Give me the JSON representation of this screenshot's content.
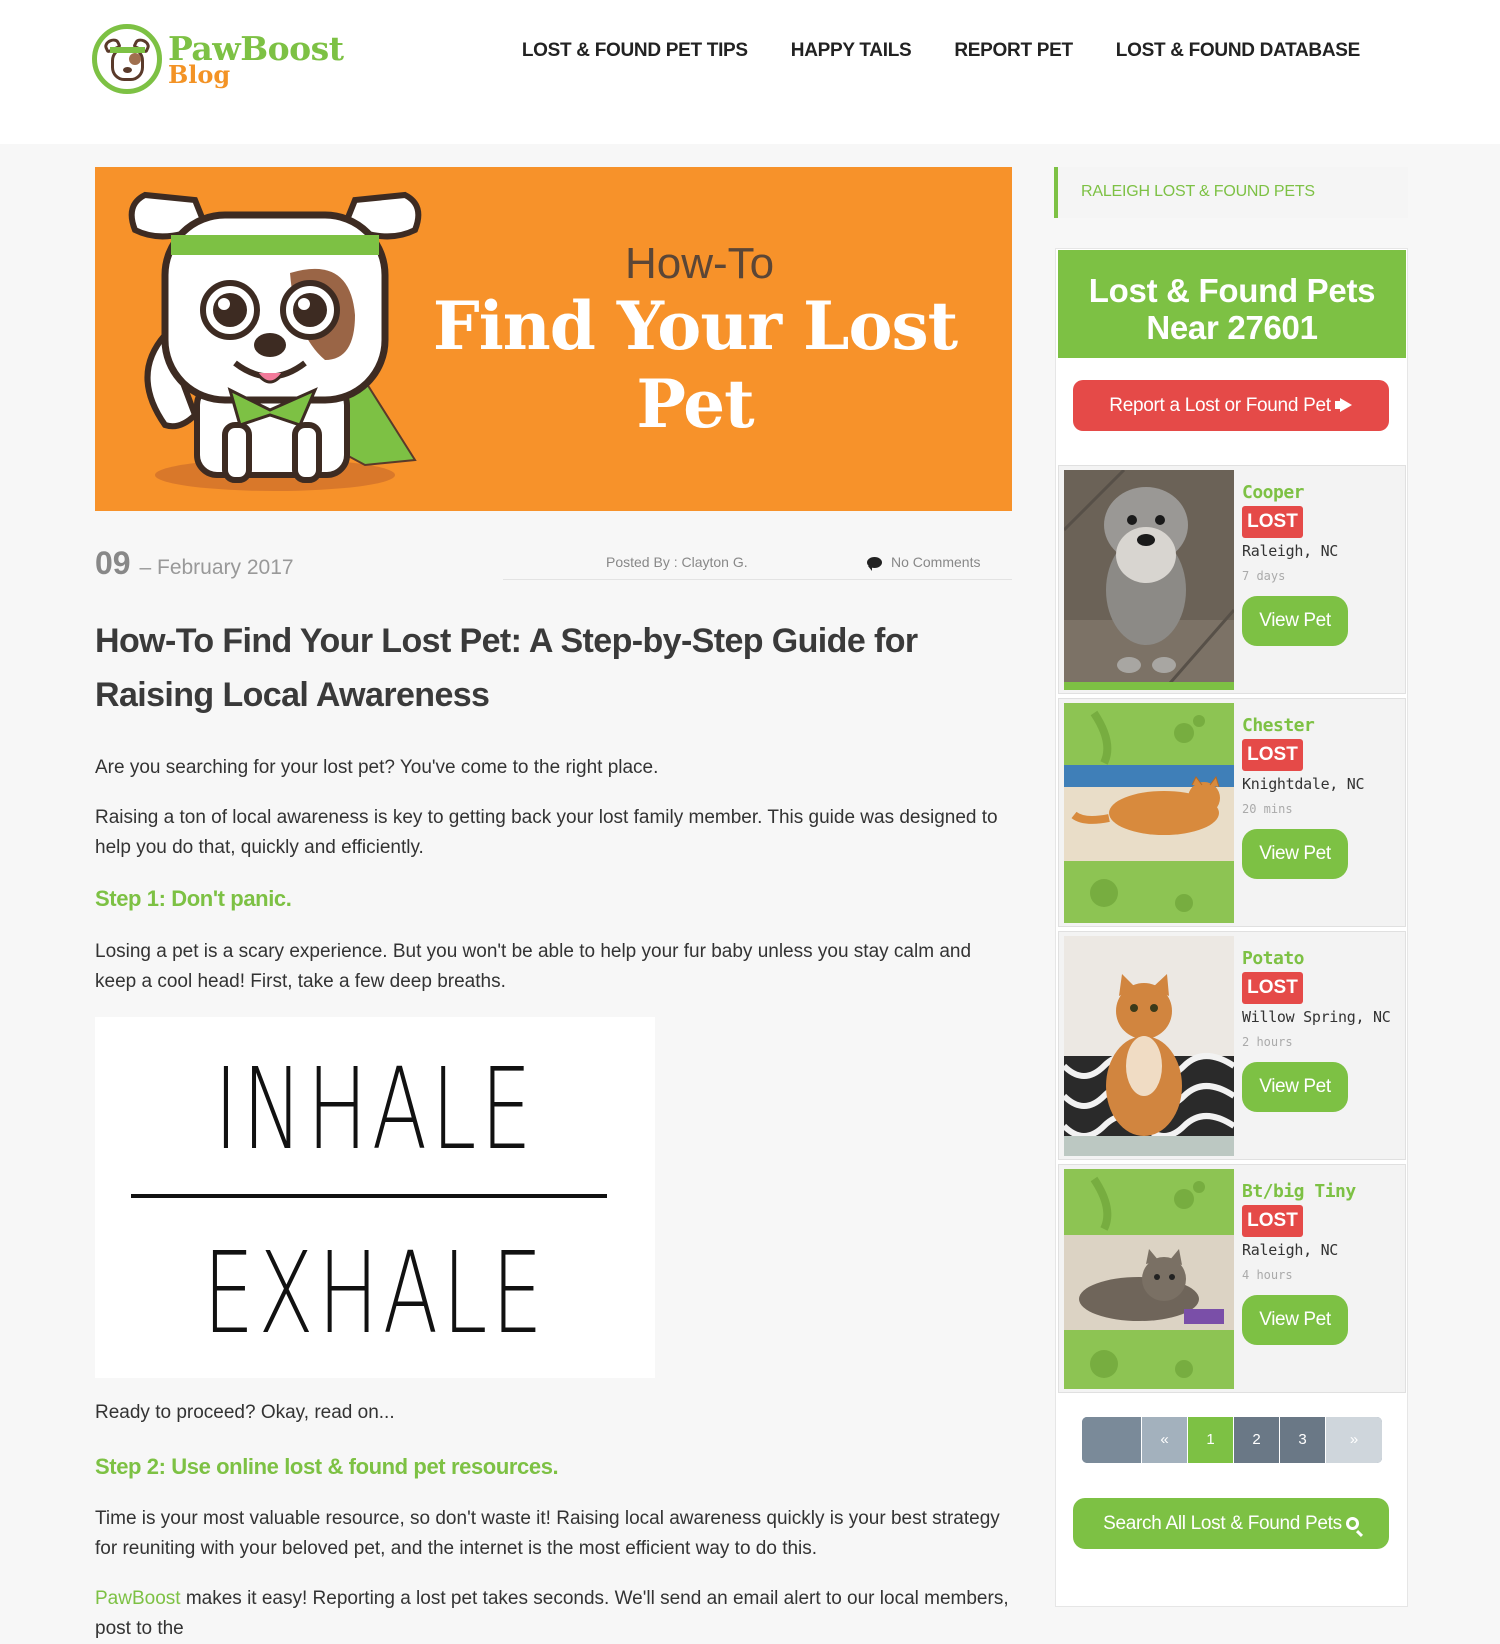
{
  "site": {
    "logo_line1": "PawBoost",
    "logo_line2": "Blog"
  },
  "nav": {
    "items": [
      "LOST & FOUND PET TIPS",
      "HAPPY TAILS",
      "REPORT PET",
      "LOST & FOUND DATABASE"
    ]
  },
  "hero": {
    "pre": "How-To",
    "title_line1": "Find Your Lost",
    "title_line2": "Pet",
    "bg_color": "#f7922a"
  },
  "meta": {
    "day": "09",
    "month_year": "– February 2017",
    "posted_by": "Posted By : Clayton G.",
    "comments": "No Comments"
  },
  "article": {
    "title": "How-To Find Your Lost Pet: A Step-by-Step Guide for Raising Local Awareness",
    "p1": "Are you searching for your lost pet? You've come to the right place.",
    "p2": "Raising a ton of local awareness is key to getting back your lost family member. This guide was designed to help you do that, quickly and efficiently.",
    "step1": "Step 1: Don't panic.",
    "p3": "Losing a pet is a scary experience. But you won't be able to help your fur baby unless you stay calm and keep a cool head! First, take a few deep breaths.",
    "image_word1": "INHALE",
    "image_word2": "EXHALE",
    "p4": "Ready to proceed? Okay, read on...",
    "step2": "Step 2: Use online lost & found pet resources.",
    "p5": "Time is your most valuable resource, so don't waste it! Raising local awareness quickly is your best strategy for reuniting with your beloved pet, and the internet is the most efficient way to do this.",
    "p6_link": "PawBoost",
    "p6_rest": " makes it easy! Reporting a lost pet takes seconds. We'll send an email alert to our local members, post to the"
  },
  "sidebar": {
    "heading": "RALEIGH LOST & FOUND PETS",
    "box_title_line1": "Lost & Found Pets",
    "box_title_line2": "Near 27601",
    "report_button": "Report a Lost or Found Pet",
    "pets": [
      {
        "name": "Cooper",
        "status": "LOST",
        "location": "Raleigh, NC",
        "time": "7 days",
        "button": "View Pet"
      },
      {
        "name": "Chester",
        "status": "LOST",
        "location": "Knightdale, NC",
        "time": "20 mins",
        "button": "View Pet"
      },
      {
        "name": "Potato",
        "status": "LOST",
        "location": "Willow Spring, NC",
        "time": "2 hours",
        "button": "View Pet"
      },
      {
        "name": "Bt/big Tiny",
        "status": "LOST",
        "location": "Raleigh, NC",
        "time": "4 hours",
        "button": "View Pet"
      }
    ],
    "pager": {
      "prev": "«",
      "pages": [
        "1",
        "2",
        "3"
      ],
      "next": "»",
      "current": "1"
    },
    "search_button": "Search All Lost & Found Pets"
  },
  "colors": {
    "brand_green": "#7dc144",
    "brand_orange": "#f39325",
    "alert_red": "#e54a48"
  }
}
